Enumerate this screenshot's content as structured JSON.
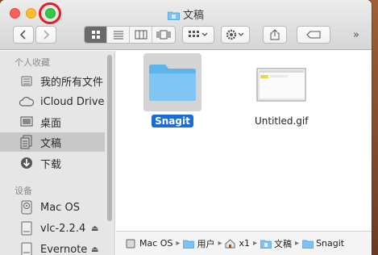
{
  "window": {
    "title": "文稿"
  },
  "toolbar": {
    "back_icon": "chevron-left-icon",
    "forward_icon": "chevron-right-icon",
    "view_modes": [
      "icon-view",
      "list-view",
      "column-view",
      "cover-flow-view"
    ],
    "active_view": "icon-view",
    "arrange_icon": "arrange-grid-icon",
    "action_icon": "gear-icon",
    "share_icon": "share-icon",
    "tag_icon": "tag-icon",
    "overflow_label": "»"
  },
  "sidebar": {
    "favorites_header": "个人收藏",
    "favorites": [
      {
        "label": "我的所有文件",
        "icon": "all-files-icon"
      },
      {
        "label": "iCloud Drive",
        "icon": "cloud-icon"
      },
      {
        "label": "桌面",
        "icon": "desktop-icon"
      },
      {
        "label": "文稿",
        "icon": "documents-icon",
        "selected": true
      },
      {
        "label": "下载",
        "icon": "download-icon"
      }
    ],
    "devices_header": "设备",
    "devices": [
      {
        "label": "Mac OS",
        "icon": "harddisk-icon"
      },
      {
        "label": "vlc-2.2.4",
        "icon": "disk-image-icon",
        "eject": "⏏"
      },
      {
        "label": "Evernote",
        "icon": "disk-image-icon",
        "eject": "⏏"
      }
    ]
  },
  "files": [
    {
      "name": "Snagit",
      "kind": "folder",
      "selected": true
    },
    {
      "name": "Untitled.gif",
      "kind": "image",
      "selected": false
    }
  ],
  "pathbar": {
    "crumbs": [
      {
        "label": "Mac OS",
        "icon": "harddisk-icon"
      },
      {
        "label": "用户",
        "icon": "folder-icon"
      },
      {
        "label": "x1",
        "icon": "home-icon"
      },
      {
        "label": "文稿",
        "icon": "documents-icon"
      },
      {
        "label": "Snagit",
        "icon": "folder-icon"
      }
    ]
  },
  "colors": {
    "selection_blue": "#1a6cd6",
    "folder_blue": "#5fb4ee",
    "annotation_red": "#e51c23"
  }
}
